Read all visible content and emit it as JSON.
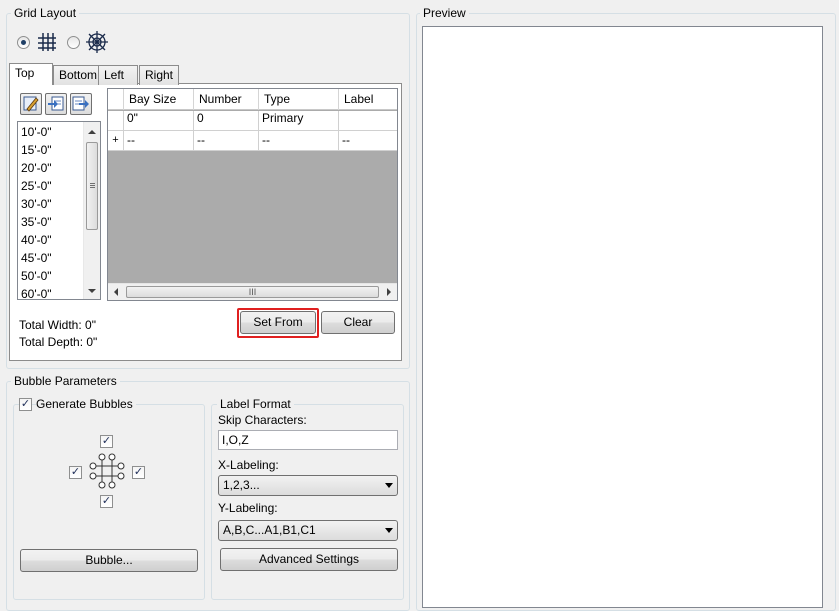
{
  "grid_layout": {
    "title": "Grid Layout",
    "mode_options": [
      {
        "icon": "rectangular-grid-icon",
        "checked": true
      },
      {
        "icon": "radial-grid-icon",
        "checked": false
      }
    ],
    "tabs": [
      "Top",
      "Bottom",
      "Left",
      "Right"
    ],
    "active_tab": "Top",
    "toolbar_icons": [
      "edit-icon",
      "import-icon",
      "export-icon"
    ],
    "spacing_list": [
      "10'-0\"",
      "15'-0\"",
      "20'-0\"",
      "25'-0\"",
      "30'-0\"",
      "35'-0\"",
      "40'-0\"",
      "45'-0\"",
      "50'-0\"",
      "60'-0\""
    ],
    "table": {
      "columns": [
        "Bay Size",
        "Number",
        "Type",
        "Label"
      ],
      "rows": [
        {
          "marker": "",
          "cells": [
            "0\"",
            "0",
            "Primary",
            ""
          ]
        },
        {
          "marker": "+",
          "cells": [
            "--",
            "--",
            "--",
            "--"
          ]
        }
      ],
      "hscroll_grip": "III"
    },
    "set_from_label": "Set From",
    "clear_label": "Clear",
    "total_width": "Total Width: 0\"",
    "total_depth": "Total Depth: 0\""
  },
  "bubble_parameters": {
    "title": "Bubble Parameters",
    "generate_bubbles_label": "Generate Bubbles",
    "generate_bubbles_checked": true,
    "sides_checked": {
      "top": true,
      "left": true,
      "right": true,
      "bottom": true
    },
    "bubble_button_label": "Bubble..."
  },
  "label_format": {
    "title": "Label Format",
    "skip_label": "Skip Characters:",
    "skip_value": "I,O,Z",
    "x_label": "X-Labeling:",
    "x_value": "1,2,3...",
    "y_label": "Y-Labeling:",
    "y_value": "A,B,C...A1,B1,C1",
    "advanced_label": "Advanced Settings"
  },
  "preview": {
    "title": "Preview"
  }
}
